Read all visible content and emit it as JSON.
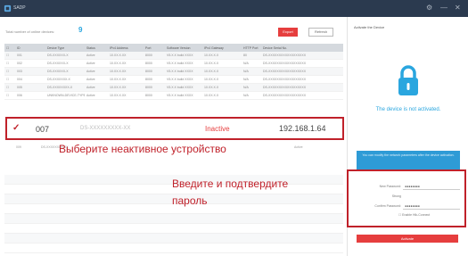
{
  "app": {
    "name": "SADP"
  },
  "window_controls": {
    "settings": "⚙",
    "minimize": "—",
    "close": "✕"
  },
  "toolbar": {
    "info_text": "Total number of online devices:",
    "device_count": "9",
    "export_label": "Export",
    "refresh_label": "Refresh"
  },
  "table": {
    "columns": [
      "ID",
      "Device Type",
      "Status",
      "IPv4 Address",
      "Port",
      "Software Version",
      "IPv4 Gateway",
      "HTTP Port",
      "Device Serial No."
    ],
    "rows": [
      [
        "001",
        "DS-XXXXXX-X",
        "Active",
        "10.XX.X.XX",
        "8000",
        "V5.X.X build XXXX",
        "10.XX.X.X",
        "80",
        "DS-XXXXXXXXXXXXXXXXXX"
      ],
      [
        "002",
        "DS-XXXXXX-X",
        "Active",
        "10.XX.X.XX",
        "8000",
        "V5.X.X build XXXX",
        "10.XX.X.X",
        "N/A",
        "DS-XXXXXXXXXXXXXXXXXX"
      ],
      [
        "003",
        "DS-XXXXXX-X",
        "Active",
        "10.XX.X.XX",
        "8000",
        "V5.X.X build XXXX",
        "10.XX.X.X",
        "N/A",
        "DS-XXXXXXXXXXXXXXXXXX"
      ],
      [
        "004",
        "DS-XXXXXXX-X",
        "Active",
        "10.XX.X.XX",
        "8000",
        "V5.X.X build XXXX",
        "10.XX.X.X",
        "N/A",
        "DS-XXXXXXXXXXXXXXXXXX"
      ],
      [
        "005",
        "DS-XXXXXXXX-X",
        "Active",
        "10.XX.X.XX",
        "8000",
        "V5.X.X build XXXX",
        "10.XX.X.X",
        "N/A",
        "DS-XXXXXXXXXXXXXXXXXX"
      ],
      [
        "006",
        "UNKNOWN-DEVICE-TYPE",
        "Active",
        "10.XX.X.XX",
        "8000",
        "V5.X.X build XXXX",
        "10.XX.X.X",
        "N/A",
        "DS-XXXXXXXXXXXXXXXXXX"
      ]
    ],
    "selected": {
      "id": "007",
      "serial": "DS-XXXXXXXXX-XX",
      "status": "Inactive",
      "ip": "192.168.1.64"
    },
    "row_after": {
      "id": "009",
      "type": "DS-XXXXXXXX-XX",
      "status": "Active"
    }
  },
  "annotations": {
    "select_device": "Выберите неактивное устройство",
    "enter_password_line1": "Введите и подтвердите",
    "enter_password_line2": "пароль"
  },
  "panel": {
    "title": "Activate the Device",
    "status": "The device is not activated.",
    "info": "You can modify the network parameters after the device activation.",
    "new_password_label": "New Password:",
    "new_password_value": "●●●●●●●●",
    "strength_label": "Strong",
    "confirm_password_label": "Confirm Password:",
    "confirm_password_value": "●●●●●●●●",
    "hik_connect_label": "Enable Hik-Connect",
    "activate_label": "Activate"
  },
  "colors": {
    "accent_red": "#c0212a",
    "button_red": "#e63e3e",
    "blue": "#2aa6df",
    "titlebar": "#2b3a4f"
  }
}
